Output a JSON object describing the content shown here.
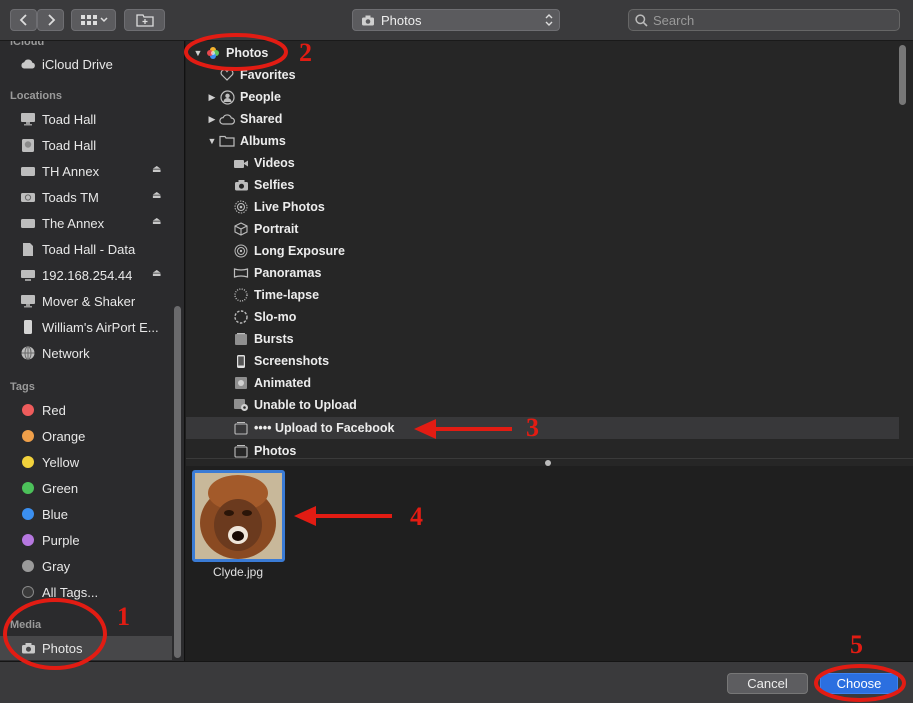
{
  "toolbar": {
    "location": "Photos",
    "search_placeholder": "Search"
  },
  "sidebar": {
    "icloud_header": "iCloud",
    "icloud_items": [
      "iCloud Drive"
    ],
    "locations_header": "Locations",
    "locations": [
      {
        "label": "Toad Hall",
        "icon": "imac-icon",
        "eject": false
      },
      {
        "label": "Toad Hall",
        "icon": "disk-icon",
        "eject": false
      },
      {
        "label": "TH Annex",
        "icon": "external-drive-icon",
        "eject": true
      },
      {
        "label": "Toads TM",
        "icon": "time-machine-icon",
        "eject": true
      },
      {
        "label": "The Annex",
        "icon": "external-drive-icon",
        "eject": true
      },
      {
        "label": "Toad Hall - Data",
        "icon": "document-icon",
        "eject": false
      },
      {
        "label": "192.168.254.44",
        "icon": "server-icon",
        "eject": true
      },
      {
        "label": "Mover & Shaker",
        "icon": "imac-icon",
        "eject": false
      },
      {
        "label": "William's AirPort E...",
        "icon": "airport-icon",
        "eject": false
      },
      {
        "label": "Network",
        "icon": "network-globe-icon",
        "eject": false
      }
    ],
    "tags_header": "Tags",
    "tags": [
      {
        "label": "Red",
        "color": "#ee5c5c"
      },
      {
        "label": "Orange",
        "color": "#f0a04a"
      },
      {
        "label": "Yellow",
        "color": "#f2d23c"
      },
      {
        "label": "Green",
        "color": "#4cc15a"
      },
      {
        "label": "Blue",
        "color": "#3b8ff0"
      },
      {
        "label": "Purple",
        "color": "#b678e0"
      },
      {
        "label": "Gray",
        "color": "#9a9a9a"
      },
      {
        "label": "All Tags...",
        "color": "#3a3a3a"
      }
    ],
    "media_header": "Media",
    "media_items": [
      "Photos"
    ]
  },
  "tree": [
    {
      "label": "Photos",
      "indent": 0,
      "tri": "▼",
      "icon": "photos-app-icon"
    },
    {
      "label": "Favorites",
      "indent": 1,
      "tri": "",
      "icon": "heart-icon"
    },
    {
      "label": "People",
      "indent": 1,
      "tri": "▶",
      "icon": "person-icon"
    },
    {
      "label": "Shared",
      "indent": 1,
      "tri": "▶",
      "icon": "cloud-icon"
    },
    {
      "label": "Albums",
      "indent": 1,
      "tri": "▼",
      "icon": "folder-icon"
    },
    {
      "label": "Videos",
      "indent": 2,
      "tri": "",
      "icon": "video-camera-icon"
    },
    {
      "label": "Selfies",
      "indent": 2,
      "tri": "",
      "icon": "camera-icon"
    },
    {
      "label": "Live Photos",
      "indent": 2,
      "tri": "",
      "icon": "live-photo-icon"
    },
    {
      "label": "Portrait",
      "indent": 2,
      "tri": "",
      "icon": "cube-icon"
    },
    {
      "label": "Long Exposure",
      "indent": 2,
      "tri": "",
      "icon": "long-exposure-icon"
    },
    {
      "label": "Panoramas",
      "indent": 2,
      "tri": "",
      "icon": "panorama-icon"
    },
    {
      "label": "Time-lapse",
      "indent": 2,
      "tri": "",
      "icon": "time-lapse-icon"
    },
    {
      "label": "Slo-mo",
      "indent": 2,
      "tri": "",
      "icon": "slo-mo-icon"
    },
    {
      "label": "Bursts",
      "indent": 2,
      "tri": "",
      "icon": "bursts-icon"
    },
    {
      "label": "Screenshots",
      "indent": 2,
      "tri": "",
      "icon": "phone-icon"
    },
    {
      "label": "Animated",
      "indent": 2,
      "tri": "",
      "icon": "animated-icon"
    },
    {
      "label": "Unable to Upload",
      "indent": 2,
      "tri": "",
      "icon": "unable-upload-icon"
    },
    {
      "label": "•••• Upload to Facebook",
      "indent": 2,
      "tri": "",
      "icon": "album-stack-icon",
      "highlight": true
    },
    {
      "label": "Photos",
      "indent": 2,
      "tri": "",
      "icon": "album-stack-icon"
    }
  ],
  "preview": {
    "file_name": "Clyde.jpg"
  },
  "buttons": {
    "cancel": "Cancel",
    "choose": "Choose"
  },
  "annotations": [
    "1",
    "2",
    "3",
    "4",
    "5"
  ]
}
